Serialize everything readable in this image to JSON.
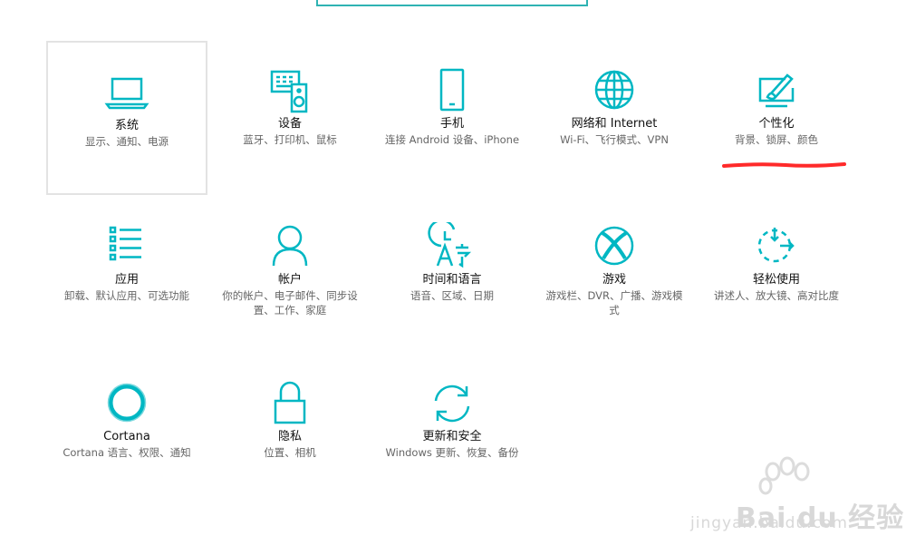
{
  "colors": {
    "accent": "#00b7c3",
    "selected_border": "#e3e3e3",
    "annotation": "#ff2a2a"
  },
  "tiles": [
    {
      "title": "系统",
      "desc": "显示、通知、电源",
      "icon": "laptop-icon",
      "selected": true
    },
    {
      "title": "设备",
      "desc": "蓝牙、打印机、鼠标",
      "icon": "devices-icon"
    },
    {
      "title": "手机",
      "desc": "连接 Android 设备、iPhone",
      "icon": "phone-icon"
    },
    {
      "title": "网络和 Internet",
      "desc": "Wi-Fi、飞行模式、VPN",
      "icon": "globe-icon"
    },
    {
      "title": "个性化",
      "desc": "背景、锁屏、颜色",
      "icon": "paintbrush-icon"
    },
    {
      "title": "应用",
      "desc": "卸载、默认应用、可选功能",
      "icon": "apps-list-icon"
    },
    {
      "title": "帐户",
      "desc": "你的帐户、电子邮件、同步设置、工作、家庭",
      "icon": "person-icon"
    },
    {
      "title": "时间和语言",
      "desc": "语音、区域、日期",
      "icon": "time-language-icon"
    },
    {
      "title": "游戏",
      "desc": "游戏栏、DVR、广播、游戏模式",
      "icon": "xbox-icon"
    },
    {
      "title": "轻松使用",
      "desc": "讲述人、放大镜、高对比度",
      "icon": "ease-of-access-icon"
    },
    {
      "title": "Cortana",
      "desc": "Cortana 语言、权限、通知",
      "icon": "cortana-ring-icon"
    },
    {
      "title": "隐私",
      "desc": "位置、相机",
      "icon": "lock-icon"
    },
    {
      "title": "更新和安全",
      "desc": "Windows 更新、恢复、备份",
      "icon": "sync-arrows-icon"
    }
  ],
  "watermark": {
    "brand": "Bai du 经验",
    "url": "jingyan.baidu.com"
  }
}
